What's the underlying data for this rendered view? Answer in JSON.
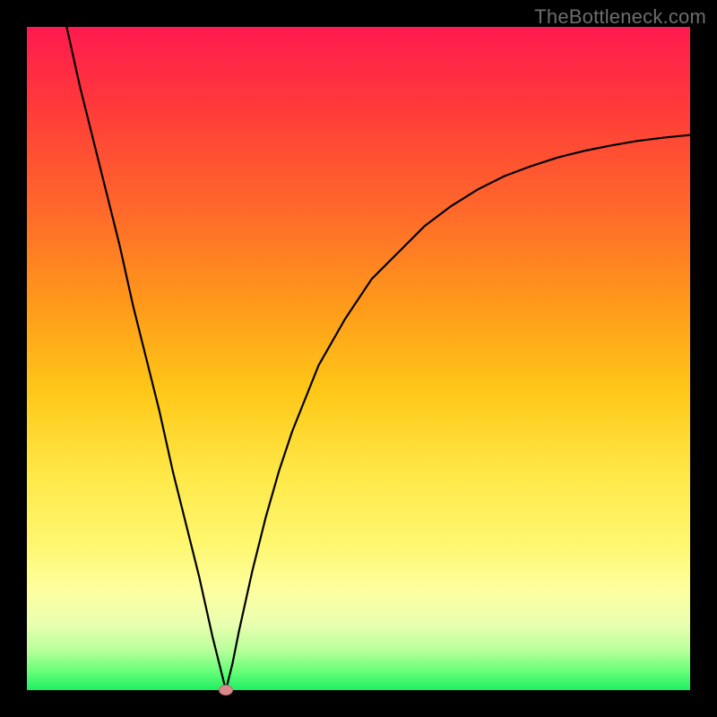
{
  "watermark": "TheBottleneck.com",
  "chart_data": {
    "type": "line",
    "title": "",
    "xlabel": "",
    "ylabel": "",
    "xlim": [
      0,
      100
    ],
    "ylim": [
      0,
      100
    ],
    "grid": false,
    "legend": false,
    "annotations": [],
    "marker": {
      "x": 30,
      "y": 0
    },
    "series": [
      {
        "name": "curve",
        "x": [
          6,
          8,
          10,
          12,
          14,
          16,
          18,
          20,
          22,
          24,
          26,
          28,
          29,
          30,
          31,
          32,
          34,
          36,
          38,
          40,
          44,
          48,
          52,
          56,
          60,
          64,
          68,
          72,
          76,
          80,
          84,
          88,
          92,
          96,
          100
        ],
        "y": [
          100,
          91,
          83,
          75,
          67,
          58,
          50,
          42,
          33,
          25,
          17,
          8,
          4,
          0,
          4,
          9,
          18,
          26,
          33,
          39,
          49,
          56,
          62,
          66,
          70,
          73,
          75.5,
          77.5,
          79,
          80.3,
          81.3,
          82.1,
          82.8,
          83.3,
          83.7
        ]
      }
    ],
    "background_gradient": {
      "stops": [
        {
          "pos": 0,
          "color": "#ff1a4f"
        },
        {
          "pos": 12,
          "color": "#ff3a3a"
        },
        {
          "pos": 28,
          "color": "#ff6a2a"
        },
        {
          "pos": 42,
          "color": "#ff9a1a"
        },
        {
          "pos": 55,
          "color": "#ffc818"
        },
        {
          "pos": 68,
          "color": "#ffe94a"
        },
        {
          "pos": 78,
          "color": "#fff770"
        },
        {
          "pos": 85,
          "color": "#fdffa0"
        },
        {
          "pos": 90,
          "color": "#eaffb0"
        },
        {
          "pos": 94,
          "color": "#b8ff9a"
        },
        {
          "pos": 97,
          "color": "#6cff7a"
        },
        {
          "pos": 100,
          "color": "#1fef63"
        }
      ]
    }
  }
}
